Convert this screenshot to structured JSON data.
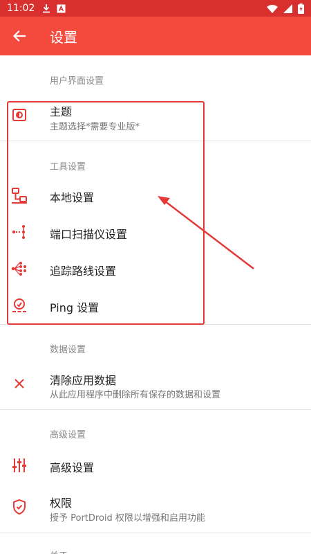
{
  "status_bar": {
    "time": "11:02",
    "left_icons": [
      "download-icon",
      "text-box-icon"
    ],
    "right_icons": [
      "wifi-icon",
      "signal-icon",
      "battery-icon"
    ],
    "color": "#d8302f"
  },
  "app_bar": {
    "title": "设置",
    "back_icon": "arrow-left-icon",
    "color": "#f44a3e"
  },
  "sections": {
    "ui": {
      "header": "用户界面设置",
      "items": [
        {
          "title": "主题",
          "subtitle": "主题选择*需要专业版*",
          "icon": "theme-icon"
        }
      ]
    },
    "tools": {
      "header": "工具设置",
      "items": [
        {
          "title": "本地设置",
          "icon": "local-network-icon"
        },
        {
          "title": "端口扫描仪设置",
          "icon": "port-scanner-icon"
        },
        {
          "title": "追踪路线设置",
          "icon": "traceroute-icon"
        },
        {
          "title": "Ping 设置",
          "icon": "ping-icon"
        }
      ]
    },
    "data": {
      "header": "数据设置",
      "items": [
        {
          "title": "清除应用数据",
          "subtitle": "从此应用程序中删除所有保存的数据和设置",
          "icon": "close-icon"
        }
      ]
    },
    "advanced": {
      "header": "高级设置",
      "items": [
        {
          "title": "高级设置",
          "icon": "sliders-icon"
        },
        {
          "title": "权限",
          "subtitle": "授予 PortDroid 权限以增强和启用功能",
          "icon": "shield-check-icon"
        }
      ]
    },
    "about": {
      "header": "关于"
    }
  },
  "accent_color": "#e53935",
  "annotation_color": "#e53935"
}
